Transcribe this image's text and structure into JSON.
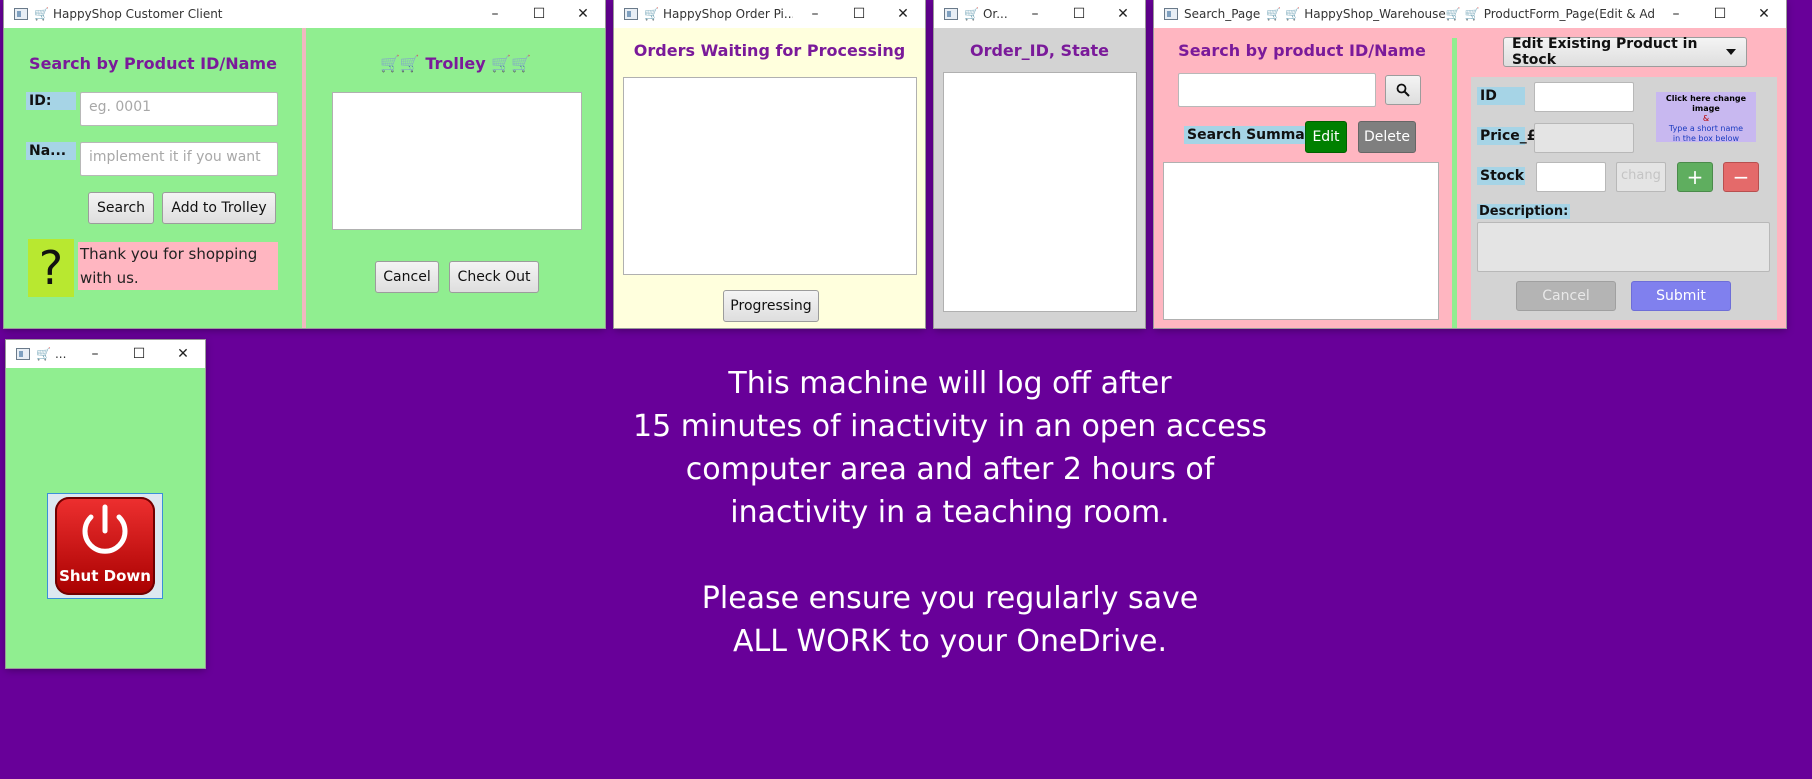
{
  "customer_window": {
    "title": "HappyShop Customer Client",
    "search_heading": "Search by Product ID/Name",
    "id_label": "ID:",
    "id_placeholder": "eg. 0001",
    "name_label": "Na...",
    "name_placeholder": "implement it if you want",
    "search_button": "Search",
    "add_button": "Add to Trolley",
    "help_symbol": "?",
    "thank_you": "Thank you for shopping with us.",
    "trolley_heading": "🛒🛒  Trolley 🛒🛒",
    "cancel_button": "Cancel",
    "checkout_button": "Check Out"
  },
  "order_picker_window": {
    "title": "HappyShop Order Pi...",
    "heading": "Orders Waiting for Processing",
    "progress_button": "Progressing"
  },
  "order_tracker_window": {
    "title": "Or...",
    "heading": "Order_ID,  State"
  },
  "warehouse_window": {
    "title_part1": "Search_Page",
    "title_part2": "HappyShop_Warehouse",
    "title_part3": "ProductForm_Page(Edit & AddNe...",
    "search_heading": "Search by product ID/Name",
    "search_icon": "magnifier",
    "summary_label": "Search Summary",
    "edit_button": "Edit",
    "delete_button": "Delete",
    "form_mode": "Edit Existing Product in Stock",
    "id_label": "ID",
    "price_label": "Price_£",
    "stock_label": "Stock",
    "change_placeholder": "chang",
    "plus_symbol": "+",
    "minus_symbol": "−",
    "image_hint_line1": "Click here change image",
    "image_hint_line2": "&",
    "image_hint_line3": "Type a short name",
    "image_hint_line4": "in the box below",
    "description_label": "Description:",
    "cancel_button": "Cancel",
    "submit_button": "Submit"
  },
  "shutdown_window": {
    "title": "...",
    "button_label": "Shut Down"
  },
  "desktop": {
    "message_lines": [
      "This machine will log off after",
      "15 minutes of inactivity in an open access",
      "computer area and after 2 hours of",
      "inactivity in a teaching room.",
      "",
      "Please ensure you regularly save",
      "ALL WORK to your OneDrive."
    ]
  },
  "colors": {
    "desktop_bg": "#680099",
    "customer_bg": "#90ee90",
    "picker_bg": "#ffffdd",
    "tracker_bg": "#d3d3d3",
    "warehouse_bg": "#ffb6c1",
    "heading_purple": "#7a1a9a",
    "edit_green": "#008000",
    "submit_blue": "#8080ee"
  }
}
